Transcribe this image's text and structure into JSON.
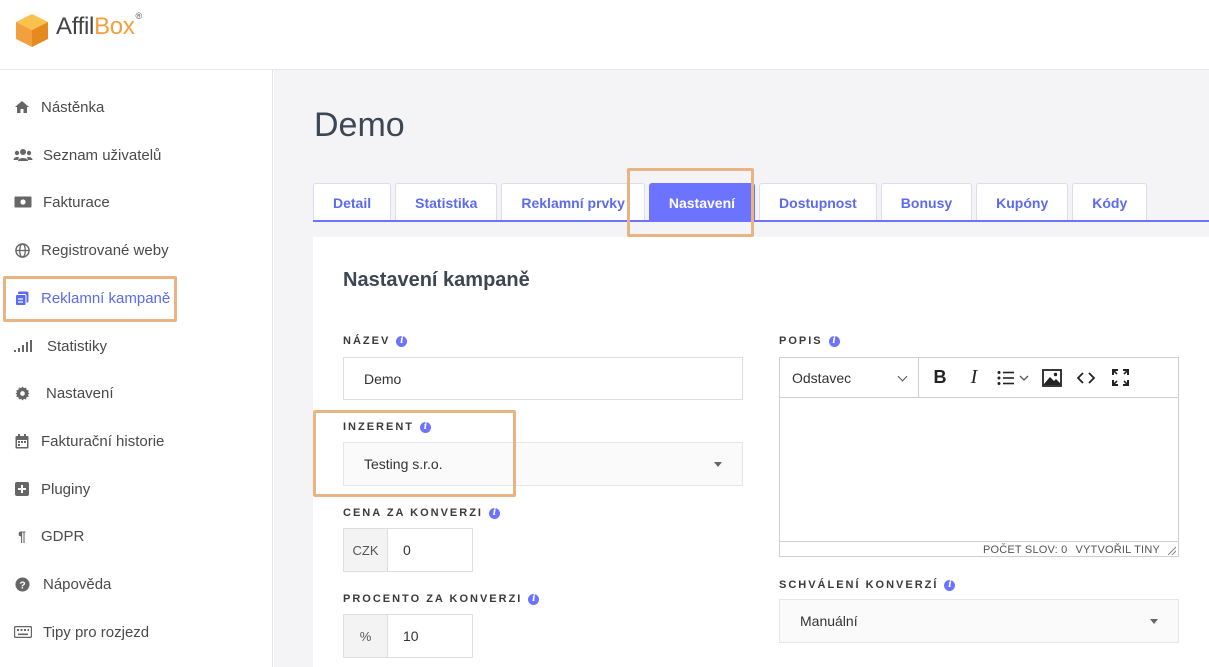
{
  "app": {
    "logo_part1": "Affil",
    "logo_part2": "Box",
    "logo_mark": "®"
  },
  "sidebar": {
    "items": [
      {
        "label": "Nástěnka",
        "icon": "home-icon"
      },
      {
        "label": "Seznam uživatelů",
        "icon": "users-icon"
      },
      {
        "label": "Fakturace",
        "icon": "money-icon"
      },
      {
        "label": "Registrované weby",
        "icon": "globe-icon"
      },
      {
        "label": "Reklamní kampaně",
        "icon": "copy-icon",
        "active": true
      },
      {
        "label": "Statistiky",
        "icon": "signal-icon"
      },
      {
        "label": "Nastavení",
        "icon": "gear-icon"
      },
      {
        "label": "Fakturační historie",
        "icon": "calendar-icon"
      },
      {
        "label": "Pluginy",
        "icon": "plus-square-icon"
      },
      {
        "label": "GDPR",
        "icon": "paragraph-icon"
      },
      {
        "label": "Nápověda",
        "icon": "question-icon"
      },
      {
        "label": "Tipy pro rozjezd",
        "icon": "keyboard-icon"
      }
    ]
  },
  "page": {
    "title": "Demo"
  },
  "tabs": [
    {
      "label": "Detail"
    },
    {
      "label": "Statistika"
    },
    {
      "label": "Reklamní prvky"
    },
    {
      "label": "Nastavení",
      "active": true
    },
    {
      "label": "Dostupnost"
    },
    {
      "label": "Bonusy"
    },
    {
      "label": "Kupóny"
    },
    {
      "label": "Kódy"
    }
  ],
  "form": {
    "section_title": "Nastavení kampaně",
    "nazev": {
      "label": "NÁZEV",
      "value": "Demo"
    },
    "inzerent": {
      "label": "INZERENT",
      "value": "Testing s.r.o."
    },
    "cena": {
      "label": "CENA ZA KONVERZI",
      "addon": "CZK",
      "value": "0"
    },
    "procento": {
      "label": "PROCENTO ZA KONVERZI",
      "addon": "%",
      "value": "10"
    },
    "popis": {
      "label": "POPIS",
      "format": "Odstavec",
      "bold": "B",
      "italic": "I",
      "status_words": "POČET SLOV: 0",
      "status_brand": "VYTVOŘIL TINY"
    },
    "schvaleni": {
      "label": "SCHVÁLENÍ KONVERZÍ",
      "value": "Manuální"
    }
  },
  "colors": {
    "accent": "#6b73ff",
    "highlight": "#eab382",
    "logo_orange": "#f2a03d"
  }
}
